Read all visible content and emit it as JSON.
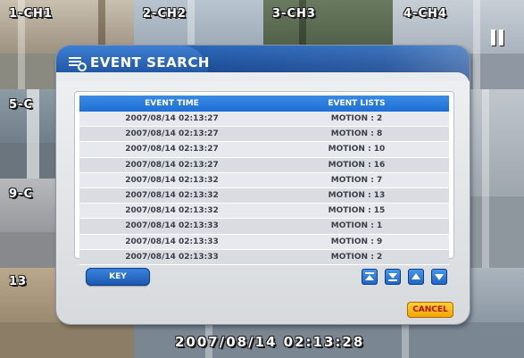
{
  "channels": [
    {
      "label": "1-CH1"
    },
    {
      "label": "2-CH2"
    },
    {
      "label": "3-CH3"
    },
    {
      "label": "4-CH4"
    },
    {
      "label": "5-C"
    },
    {
      "label": "9-C"
    },
    {
      "label": "13"
    }
  ],
  "overlay": {
    "pause_icon": "pause-icon",
    "datetime": "2007/08/14  02:13:28"
  },
  "dialog": {
    "title": "EVENT SEARCH",
    "title_icon": "event-list-icon",
    "columns": [
      "EVENT TIME",
      "EVENT LISTS"
    ],
    "rows": [
      {
        "time": "2007/08/14 02:13:27",
        "event": "MOTION : 2"
      },
      {
        "time": "2007/08/14 02:13:27",
        "event": "MOTION : 8"
      },
      {
        "time": "2007/08/14 02:13:27",
        "event": "MOTION : 10"
      },
      {
        "time": "2007/08/14 02:13:27",
        "event": "MOTION : 16"
      },
      {
        "time": "2007/08/14 02:13:32",
        "event": "MOTION : 7"
      },
      {
        "time": "2007/08/14 02:13:32",
        "event": "MOTION : 13"
      },
      {
        "time": "2007/08/14 02:13:32",
        "event": "MOTION : 15"
      },
      {
        "time": "2007/08/14 02:13:33",
        "event": "MOTION : 1"
      },
      {
        "time": "2007/08/14 02:13:33",
        "event": "MOTION : 9"
      },
      {
        "time": "2007/08/14 02:13:33",
        "event": "MOTION : 2"
      }
    ],
    "key_button": "KEY",
    "cancel_button": "CANCEL",
    "nav_buttons": [
      "first-page-icon",
      "last-page-icon",
      "up-arrow-icon",
      "down-arrow-icon"
    ],
    "colors": {
      "header_blue": "#1e6fd4",
      "title_blue": "#153e85",
      "cancel_yellow": "#f0a400"
    }
  }
}
